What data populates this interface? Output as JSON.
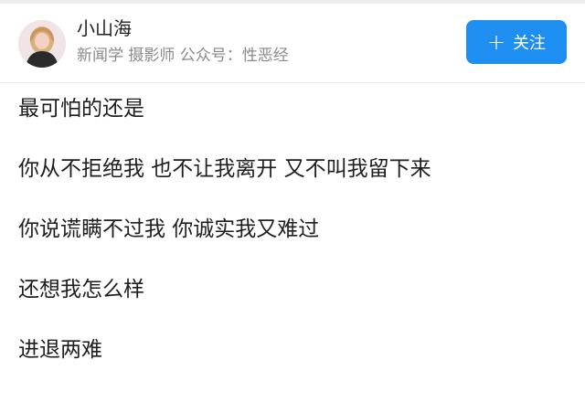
{
  "user": {
    "name": "小山海",
    "description": "新闻学 摄影师 公众号：性恶经",
    "avatar_icon": "avatar-photo"
  },
  "follow_button": {
    "icon": "plus",
    "label": "关注",
    "color": "#1f8ef1"
  },
  "post": {
    "lines": [
      "最可怕的还是",
      "你从不拒绝我 也不让我离开 又不叫我留下来",
      "你说谎瞒不过我 你诚实我又难过",
      "还想我怎么样",
      "进退两难"
    ]
  }
}
